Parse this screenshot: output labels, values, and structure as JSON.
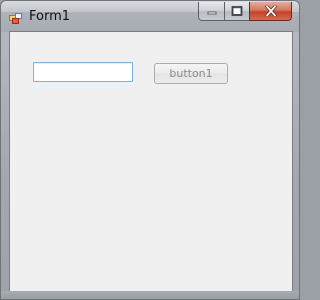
{
  "window": {
    "title": "Form1"
  },
  "titlebar": {
    "app_icon": "form-icon",
    "minimize_icon": "minimize-icon",
    "maximize_icon": "maximize-icon",
    "close_icon": "close-icon"
  },
  "form": {
    "textbox_value": "",
    "button_label": "button1"
  },
  "colors": {
    "client_background": "#f0f0f0",
    "textbox_border": "#7fb2d9",
    "close_button": "#c2432a"
  }
}
